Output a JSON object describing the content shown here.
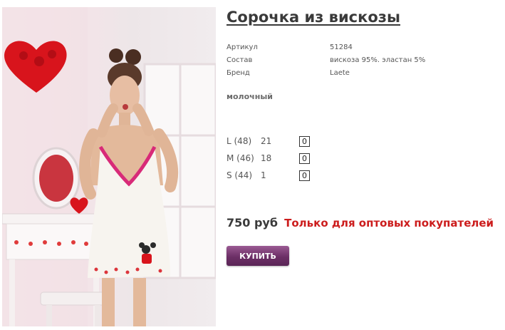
{
  "product": {
    "title": "Сорочка из вискозы",
    "specs": [
      {
        "label": "Артикул",
        "value": "51284"
      },
      {
        "label": "Состав",
        "value": "вискоза 95%. эластан 5%"
      },
      {
        "label": "Бренд",
        "value": "Laete"
      }
    ],
    "color": "молочный",
    "sizes": [
      {
        "label": "L (48)",
        "stock": "21",
        "qty": "0"
      },
      {
        "label": "M (46)",
        "stock": "18",
        "qty": "0"
      },
      {
        "label": "S (44)",
        "stock": "1",
        "qty": "0"
      }
    ],
    "price": "750 руб",
    "wholesale_note": "Только для оптовых покупателей",
    "buy_label": "КУПИТЬ"
  },
  "colors": {
    "note_red": "#cc1d1d",
    "button_purple": "#6c2f66"
  }
}
